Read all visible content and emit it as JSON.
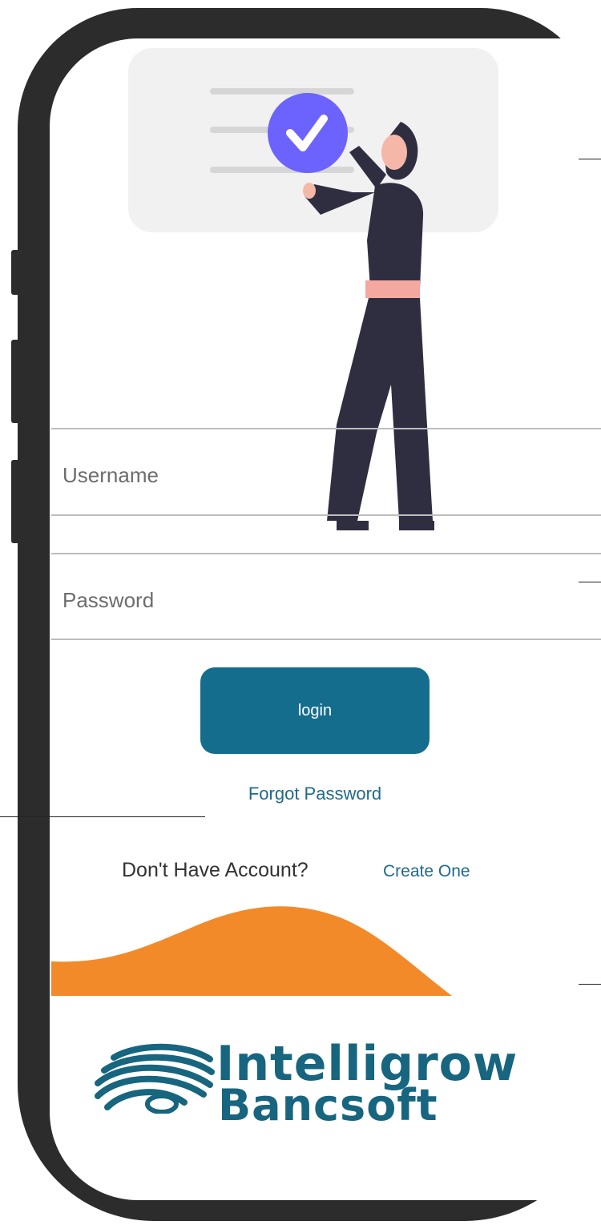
{
  "form": {
    "username_placeholder": "Username",
    "password_placeholder": "Password",
    "login_label": "login",
    "forgot_password": "Forgot Password",
    "no_account_text": "Don't Have Account?",
    "create_one": "Create One"
  },
  "brand": {
    "name_line1": "Intelligrow",
    "name_line2": "Bancsoft"
  },
  "colors": {
    "primary": "#156d8e",
    "link": "#1f6a8b",
    "accent": "#f28a2a",
    "check_badge": "#6c63ff"
  }
}
